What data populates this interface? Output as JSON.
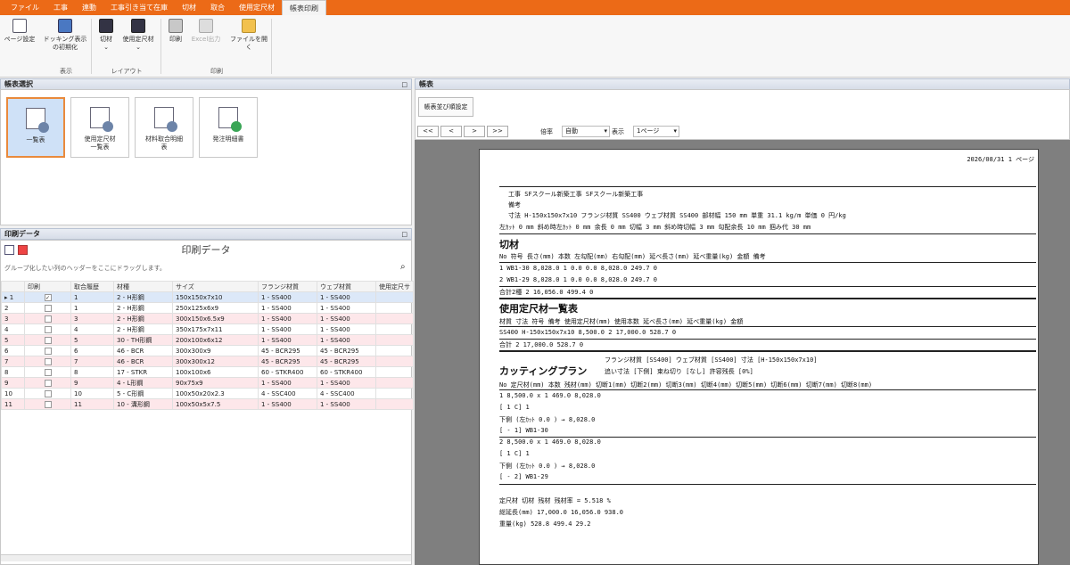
{
  "menu": [
    "ファイル",
    "工事",
    "連動",
    "工事引き当て在庫",
    "切材",
    "取合",
    "使用定尺材",
    "帳表印刷"
  ],
  "ribbon": {
    "buttons": {
      "page_setup": "ページ設定",
      "docking_init_1": "ドッキング表示",
      "docking_init_2": "の初期化",
      "cut": "切材",
      "used_std": "使用定尺材",
      "print": "印刷",
      "excel": "Excel出力",
      "open_file": "ファイルを開く"
    },
    "groups": {
      "display": "表示",
      "layout": "レイアウト",
      "print": "印刷"
    }
  },
  "report_select": {
    "title": "帳表選択",
    "tiles": [
      {
        "l1": "一覧表",
        "l2": ""
      },
      {
        "l1": "使用定尺材",
        "l2": "一覧表"
      },
      {
        "l1": "材料取合明細",
        "l2": "表"
      },
      {
        "l1": "発注明細書",
        "l2": ""
      }
    ]
  },
  "print_data": {
    "panel_title": "印刷データ",
    "grid_title": "印刷データ",
    "group_hint": "グループ化したい列のヘッダーをここにドラッグします。",
    "columns": [
      "印刷",
      "取合履歴",
      "材種",
      "サイズ",
      "フランジ材質",
      "ウェブ材質",
      "使用定尺サ"
    ],
    "rows": [
      {
        "n": "1",
        "h": "1",
        "k": "2 - H形鋼",
        "s": "150x150x7x10",
        "f": "1 - SS400",
        "w": "1 - SS400",
        "checked": true
      },
      {
        "n": "2",
        "h": "1",
        "k": "2 - H形鋼",
        "s": "250x125x6x9",
        "f": "1 - SS400",
        "w": "1 - SS400",
        "checked": false
      },
      {
        "n": "3",
        "h": "3",
        "k": "2 - H形鋼",
        "s": "300x150x6.5x9",
        "f": "1 - SS400",
        "w": "1 - SS400",
        "checked": false
      },
      {
        "n": "4",
        "h": "4",
        "k": "2 - H形鋼",
        "s": "350x175x7x11",
        "f": "1 - SS400",
        "w": "1 - SS400",
        "checked": false
      },
      {
        "n": "5",
        "h": "5",
        "k": "30 - TH形鋼",
        "s": "200x100x6x12",
        "f": "1 - SS400",
        "w": "1 - SS400",
        "checked": false
      },
      {
        "n": "6",
        "h": "6",
        "k": "46 - BCR",
        "s": "300x300x9",
        "f": "45 - BCR295",
        "w": "45 - BCR295",
        "checked": false
      },
      {
        "n": "7",
        "h": "7",
        "k": "46 - BCR",
        "s": "300x300x12",
        "f": "45 - BCR295",
        "w": "45 - BCR295",
        "checked": false
      },
      {
        "n": "8",
        "h": "8",
        "k": "17 - STKR",
        "s": "100x100x6",
        "f": "60 - STKR400",
        "w": "60 - STKR400",
        "checked": false
      },
      {
        "n": "9",
        "h": "9",
        "k": "4 - L形鋼",
        "s": "90x75x9",
        "f": "1 - SS400",
        "w": "1 - SS400",
        "checked": false
      },
      {
        "n": "10",
        "h": "10",
        "k": "5 - C形鋼",
        "s": "100x50x20x2.3",
        "f": "4 - SSC400",
        "w": "4 - SSC400",
        "checked": false
      },
      {
        "n": "11",
        "h": "11",
        "k": "10 - 溝形鋼",
        "s": "100x50x5x7.5",
        "f": "1 - SS400",
        "w": "1 - SS400",
        "checked": false
      }
    ]
  },
  "report": {
    "panel_title": "帳表",
    "order_settings": "帳表並び順設定",
    "nav": [
      "<<",
      "<",
      ">",
      ">>"
    ],
    "zoom_label": "倍率",
    "zoom_value": "自動",
    "view_label": "表示",
    "view_value": "1ページ",
    "page": {
      "date": "2026/08/31 1 ページ",
      "h1": "工事  SFスクール新築工事    SFスクール新築工事",
      "h2": "備考",
      "h3": "寸法   H-150x150x7x10        フランジ材質 SS400        ウェブ材質  SS400        部材幅  150 mm    単重    31.1 kg/m       単価   0 円/kg",
      "h4": "左ｶｯﾄ   0 mm    斜め時左ｶｯﾄ   0 mm     余長   0 mm     切幅    3 mm     斜め時切幅   3 mm     勾配余長    10 mm    掴み代   30 mm",
      "cut_title": "切材",
      "cut_header": "No  符号            長さ(mm)   本数   左勾配(mm) 右勾配(mm) 延べ長さ(mm)  延べ重量(kg)   金額           備考",
      "cut_rows": [
        "  1 WB1-30           8,028.0     1      0.0       0.0      8,028.0        249.7          0",
        "  2 WB1-29           8,028.0     1      0.0       0.0      8,028.0        249.7          0"
      ],
      "cut_total": "合計2種                       2                          16,056.0        499.4          0",
      "std_title": "使用定尺材一覧表",
      "std_header": "材質        寸法             符号                 備考               使用定尺材(mm) 使用本数  延べ長さ(mm)    延べ重量(kg)     金額",
      "std_row": "SS400           H-150x150x7x10                                                     8,500.0          2       17,000.0            528.7            0",
      "std_total": "合計                                                                                             2       17,000.0            528.7            0",
      "cp_info1": "フランジ材質 [SS400]            ウェブ材質  [SS400]          寸法        [H-150x150x7x10]",
      "cp_title": "カッティングプラン",
      "cp_info2": "追い寸法  [下側]              束ね切り    [なし]           許容残長    [0%]",
      "cp_header": "No  定尺材(mm)   本数    残材(mm)       切断1(mm)     切断2(mm)    切断3(mm)    切断4(mm)    切断5(mm)    切断6(mm)    切断7(mm)    切断8(mm)",
      "cp1_a": "  1   8,500.0   x    1         469.0         8,028.0",
      "cp1_b": "                                  [     1  C]           1",
      "cp1_c": "  下側 (左ｶｯﾄ                      0.0 ) →     8,028.0",
      "cp1_d": "  [ - 1]                                      WB1-30",
      "cp2_a": "  2   8,500.0   x    1         469.0         8,028.0",
      "cp2_b": "                                  [     1  C]           1",
      "cp2_c": "  下側 (左ｶｯﾄ                      0.0 ) →     8,028.0",
      "cp2_d": "  [ - 2]                                      WB1-29",
      "sum_header": "                  定尺材           切材           残材                残材率 = 5.518 %",
      "sum_len": "総延長(mm)          17,000.0       16,056.0         938.0",
      "sum_wt": "重量(kg)               528.8          499.4          29.2"
    }
  }
}
